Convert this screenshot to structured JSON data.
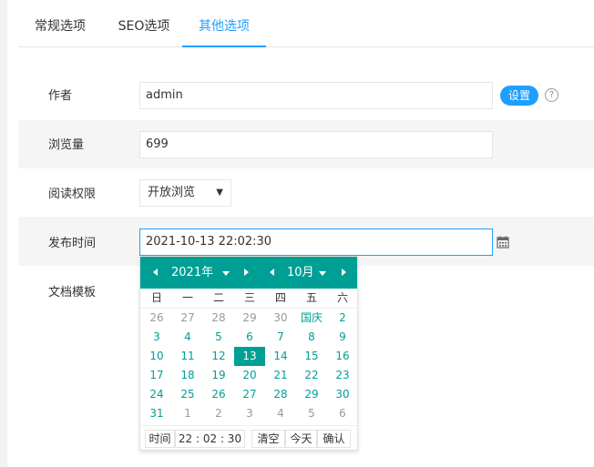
{
  "tabs": [
    {
      "label": "常规选项",
      "active": false
    },
    {
      "label": "SEO选项",
      "active": false
    },
    {
      "label": "其他选项",
      "active": true
    }
  ],
  "form": {
    "author": {
      "label": "作者",
      "value": "admin",
      "set_button": "设置",
      "help_glyph": "?"
    },
    "views": {
      "label": "浏览量",
      "value": "699"
    },
    "permission": {
      "label": "阅读权限",
      "selected": "开放浏览"
    },
    "publish_time": {
      "label": "发布时间",
      "value": "2021-10-13 22:02:30"
    },
    "template": {
      "label": "文档模板"
    }
  },
  "datepicker": {
    "year_label": "2021年",
    "month_label": "10月",
    "weekdays": [
      "日",
      "一",
      "二",
      "三",
      "四",
      "五",
      "六"
    ],
    "weeks": [
      [
        {
          "d": "26",
          "out": true
        },
        {
          "d": "27",
          "out": true
        },
        {
          "d": "28",
          "out": true
        },
        {
          "d": "29",
          "out": true
        },
        {
          "d": "30",
          "out": true
        },
        {
          "d": "国庆",
          "out": false
        },
        {
          "d": "2",
          "out": false
        }
      ],
      [
        {
          "d": "3",
          "out": false
        },
        {
          "d": "4",
          "out": false
        },
        {
          "d": "5",
          "out": false
        },
        {
          "d": "6",
          "out": false
        },
        {
          "d": "7",
          "out": false
        },
        {
          "d": "8",
          "out": false
        },
        {
          "d": "9",
          "out": false
        }
      ],
      [
        {
          "d": "10",
          "out": false
        },
        {
          "d": "11",
          "out": false
        },
        {
          "d": "12",
          "out": false
        },
        {
          "d": "13",
          "out": false,
          "selected": true
        },
        {
          "d": "14",
          "out": false
        },
        {
          "d": "15",
          "out": false
        },
        {
          "d": "16",
          "out": false
        }
      ],
      [
        {
          "d": "17",
          "out": false
        },
        {
          "d": "18",
          "out": false
        },
        {
          "d": "19",
          "out": false
        },
        {
          "d": "20",
          "out": false
        },
        {
          "d": "21",
          "out": false
        },
        {
          "d": "22",
          "out": false
        },
        {
          "d": "23",
          "out": false
        }
      ],
      [
        {
          "d": "24",
          "out": false
        },
        {
          "d": "25",
          "out": false
        },
        {
          "d": "26",
          "out": false
        },
        {
          "d": "27",
          "out": false
        },
        {
          "d": "28",
          "out": false
        },
        {
          "d": "29",
          "out": false
        },
        {
          "d": "30",
          "out": false
        }
      ],
      [
        {
          "d": "31",
          "out": false
        },
        {
          "d": "1",
          "out": true
        },
        {
          "d": "2",
          "out": true
        },
        {
          "d": "3",
          "out": true
        },
        {
          "d": "4",
          "out": true
        },
        {
          "d": "5",
          "out": true
        },
        {
          "d": "6",
          "out": true
        }
      ]
    ],
    "footer": {
      "time_label": "时间",
      "time_value": "22 : 02 : 30",
      "clear": "清空",
      "today": "今天",
      "confirm": "确认"
    }
  },
  "colors": {
    "accent": "#1e9fff",
    "picker": "#009f95"
  }
}
